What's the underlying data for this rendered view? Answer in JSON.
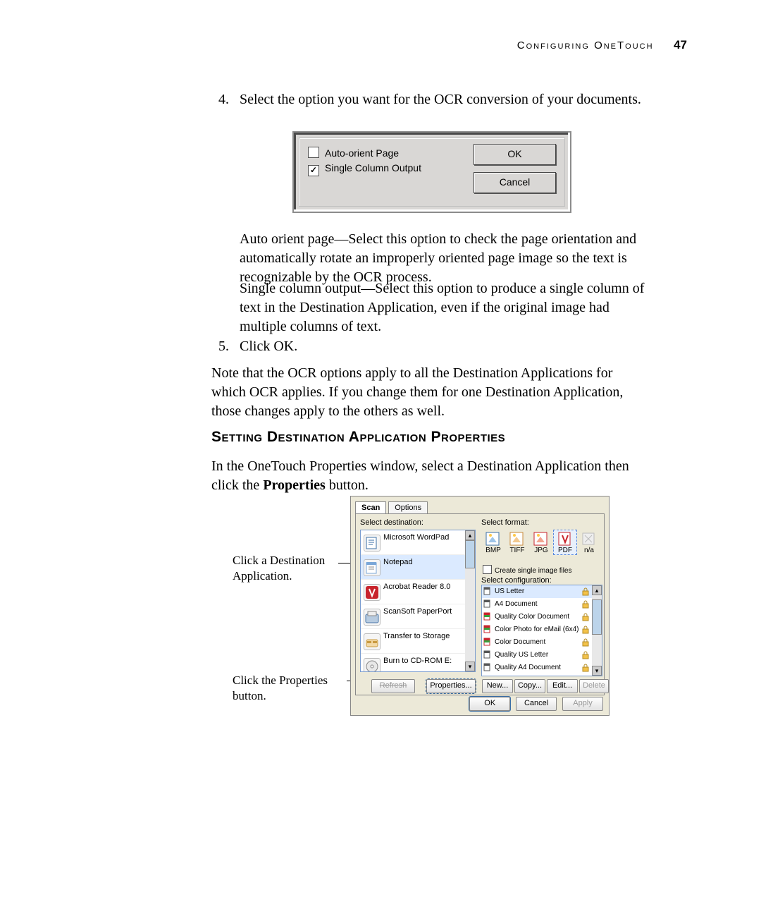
{
  "header": {
    "section_title": "Configuring OneTouch",
    "page_number": "47"
  },
  "paragraphs": {
    "p1": "Select the option you want for the OCR conversion of your documents.",
    "p1a": "Auto orient page—Select this option to check the page orientation and automatically rotate an improperly oriented page image so the text is recognizable by the OCR process.",
    "p2": "Single column output—Select this option to produce a single column of text in the Destination Application, even if the original image had multiple columns of text.",
    "p3": "Click OK.",
    "p4": "Note that the OCR options apply to all the Destination Applications for which OCR applies. If you change them for one Destination Application, those changes apply to the others as well."
  },
  "section_heading": "Setting Destination Application Properties",
  "p5_before": "In the OneTouch Properties window, select a Destination Application then click the ",
  "p5_strong": "Properties",
  "p5_after": " button.",
  "dialog1": {
    "check_auto_orient": "Auto-orient Page",
    "check_single_column": "Single Column Output",
    "check_single_column_checked": "✓",
    "ok": "OK",
    "cancel": "Cancel"
  },
  "annotations": {
    "click_dest": "Click a Destination Application.",
    "click_props": "Click the Properties button."
  },
  "dialog2": {
    "tabs": {
      "scan": "Scan",
      "options": "Options"
    },
    "labels": {
      "dest": "Select destination:",
      "format": "Select format:",
      "config": "Select configuration:"
    },
    "destinations": {
      "0": "Microsoft WordPad",
      "1": "Notepad",
      "2": "Acrobat Reader 8.0",
      "3": "ScanSoft PaperPort",
      "4": "Transfer to Storage",
      "5": "Burn to CD-ROM  E:"
    },
    "dest_buttons": {
      "refresh": "Refresh",
      "properties": "Properties..."
    },
    "formats": {
      "0": "BMP",
      "1": "TIFF",
      "2": "JPG",
      "3": "PDF",
      "4": "n/a"
    },
    "create_single": "Create single image files",
    "configs": {
      "0": "US Letter",
      "1": "A4 Document",
      "2": "Quality Color Document",
      "3": "Color Photo for eMail (6x4)",
      "4": "Color Document",
      "5": "Quality US Letter",
      "6": "Quality A4 Document"
    },
    "cfg_buttons": {
      "new": "New...",
      "copy": "Copy...",
      "edit": "Edit...",
      "delete": "Delete"
    },
    "bottom": {
      "ok": "OK",
      "cancel": "Cancel",
      "apply": "Apply"
    }
  }
}
